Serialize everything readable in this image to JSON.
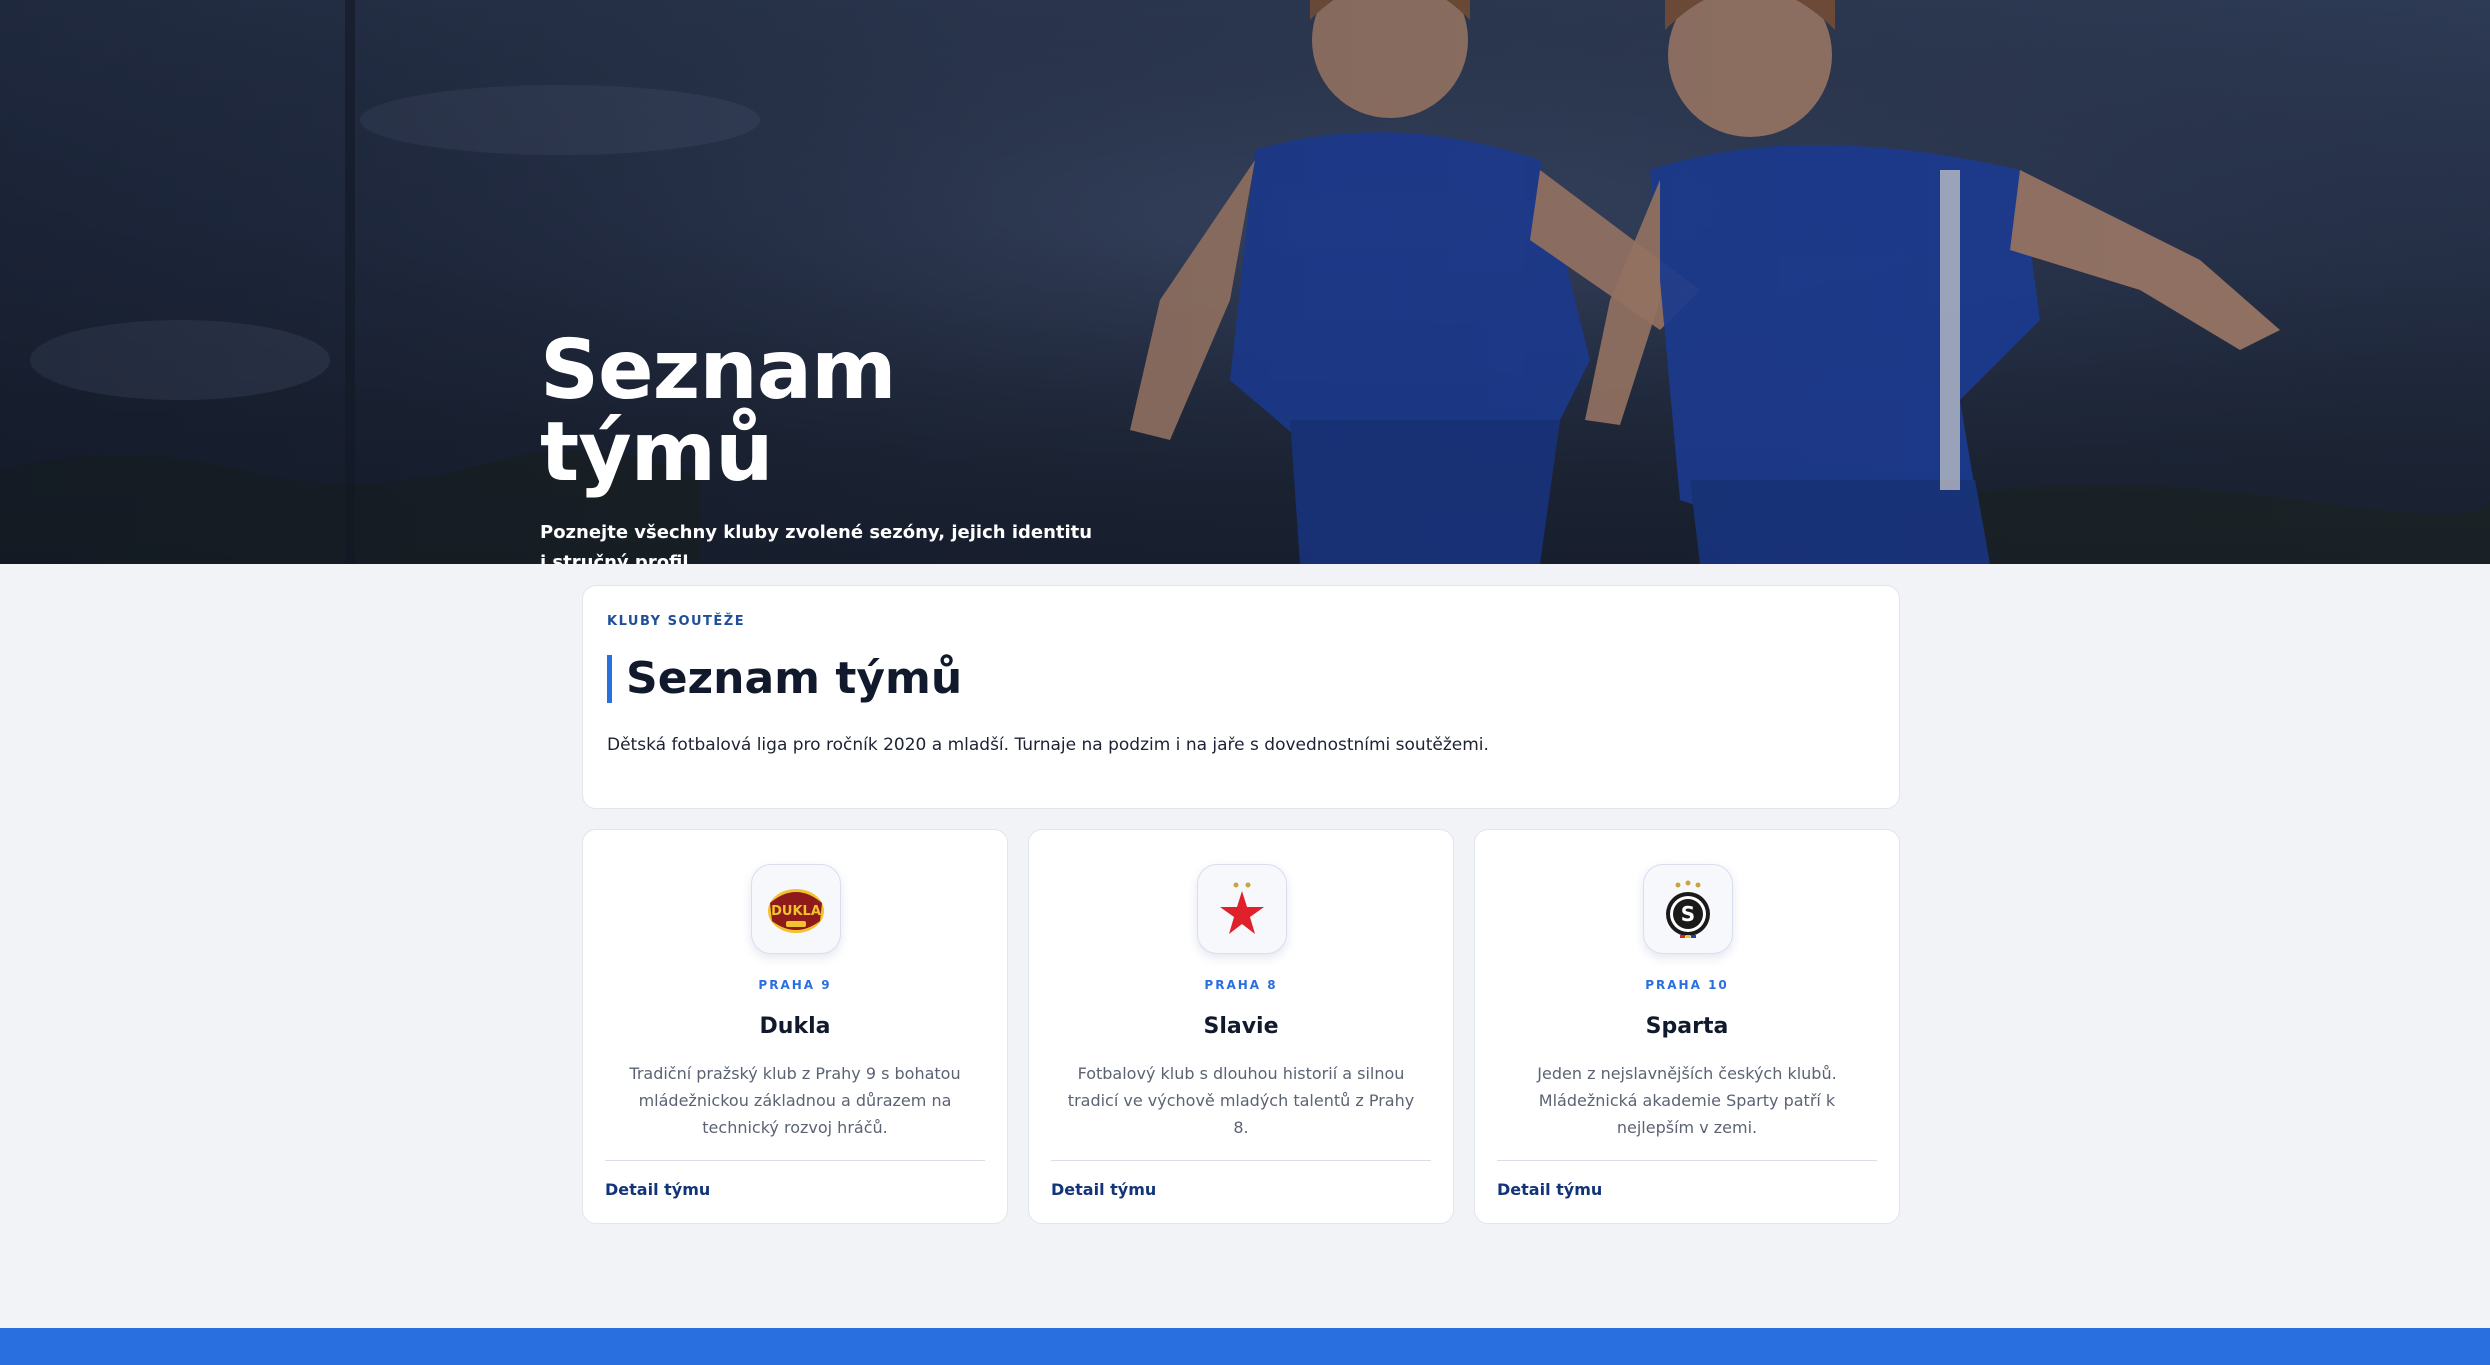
{
  "hero": {
    "title": "Seznam týmů",
    "subtitle": "Poznejte všechny kluby zvolené sezóny, jejich identitu i stručný profil."
  },
  "intro": {
    "eyebrow": "KLUBY SOUTĚŽE",
    "title": "Seznam týmů",
    "description": "Dětská fotbalová liga pro ročník 2020 a mladší. Turnaje na podzim i na jaře s dovednostními soutěžemi."
  },
  "teams": [
    {
      "district": "PRAHA 9",
      "name": "Dukla",
      "description": "Tradiční pražský klub z Prahy 9 s bohatou mládežnickou základnou a důrazem na technický rozvoj hráčů.",
      "link_label": "Detail týmu",
      "logo": "dukla-logo",
      "logo_text": "DUKLA"
    },
    {
      "district": "PRAHA 8",
      "name": "Slavie",
      "description": "Fotbalový klub s dlouhou historií a silnou tradicí ve výchově mladých talentů z Prahy 8.",
      "link_label": "Detail týmu",
      "logo": "slavia-logo"
    },
    {
      "district": "PRAHA 10",
      "name": "Sparta",
      "description": "Jeden z nejslavnějších českých klubů. Mládežnická akademie Sparty patří k nejlepším v zemi.",
      "link_label": "Detail týmu",
      "logo": "sparta-logo",
      "logo_text": "S"
    }
  ],
  "colors": {
    "accent": "#2a6fe0",
    "link": "#12357a",
    "page_bg": "#f1f3f7"
  }
}
